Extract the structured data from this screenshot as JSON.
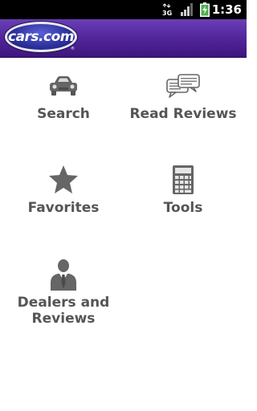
{
  "status_bar": {
    "network": "3G",
    "time": "1:36"
  },
  "header": {
    "logo_text": "cars.com",
    "logo_tm": "®"
  },
  "menu": {
    "items": [
      {
        "label": "Search",
        "icon": "car-icon"
      },
      {
        "label": "Read Reviews",
        "icon": "speech-bubbles-icon"
      },
      {
        "label": "Favorites",
        "icon": "star-icon"
      },
      {
        "label": "Tools",
        "icon": "calculator-icon"
      },
      {
        "label": "Dealers and\nReviews",
        "icon": "dealer-person-icon"
      }
    ]
  },
  "colors": {
    "header_purple": "#54279e",
    "icon_gray": "#666666",
    "label_gray": "#555555"
  }
}
